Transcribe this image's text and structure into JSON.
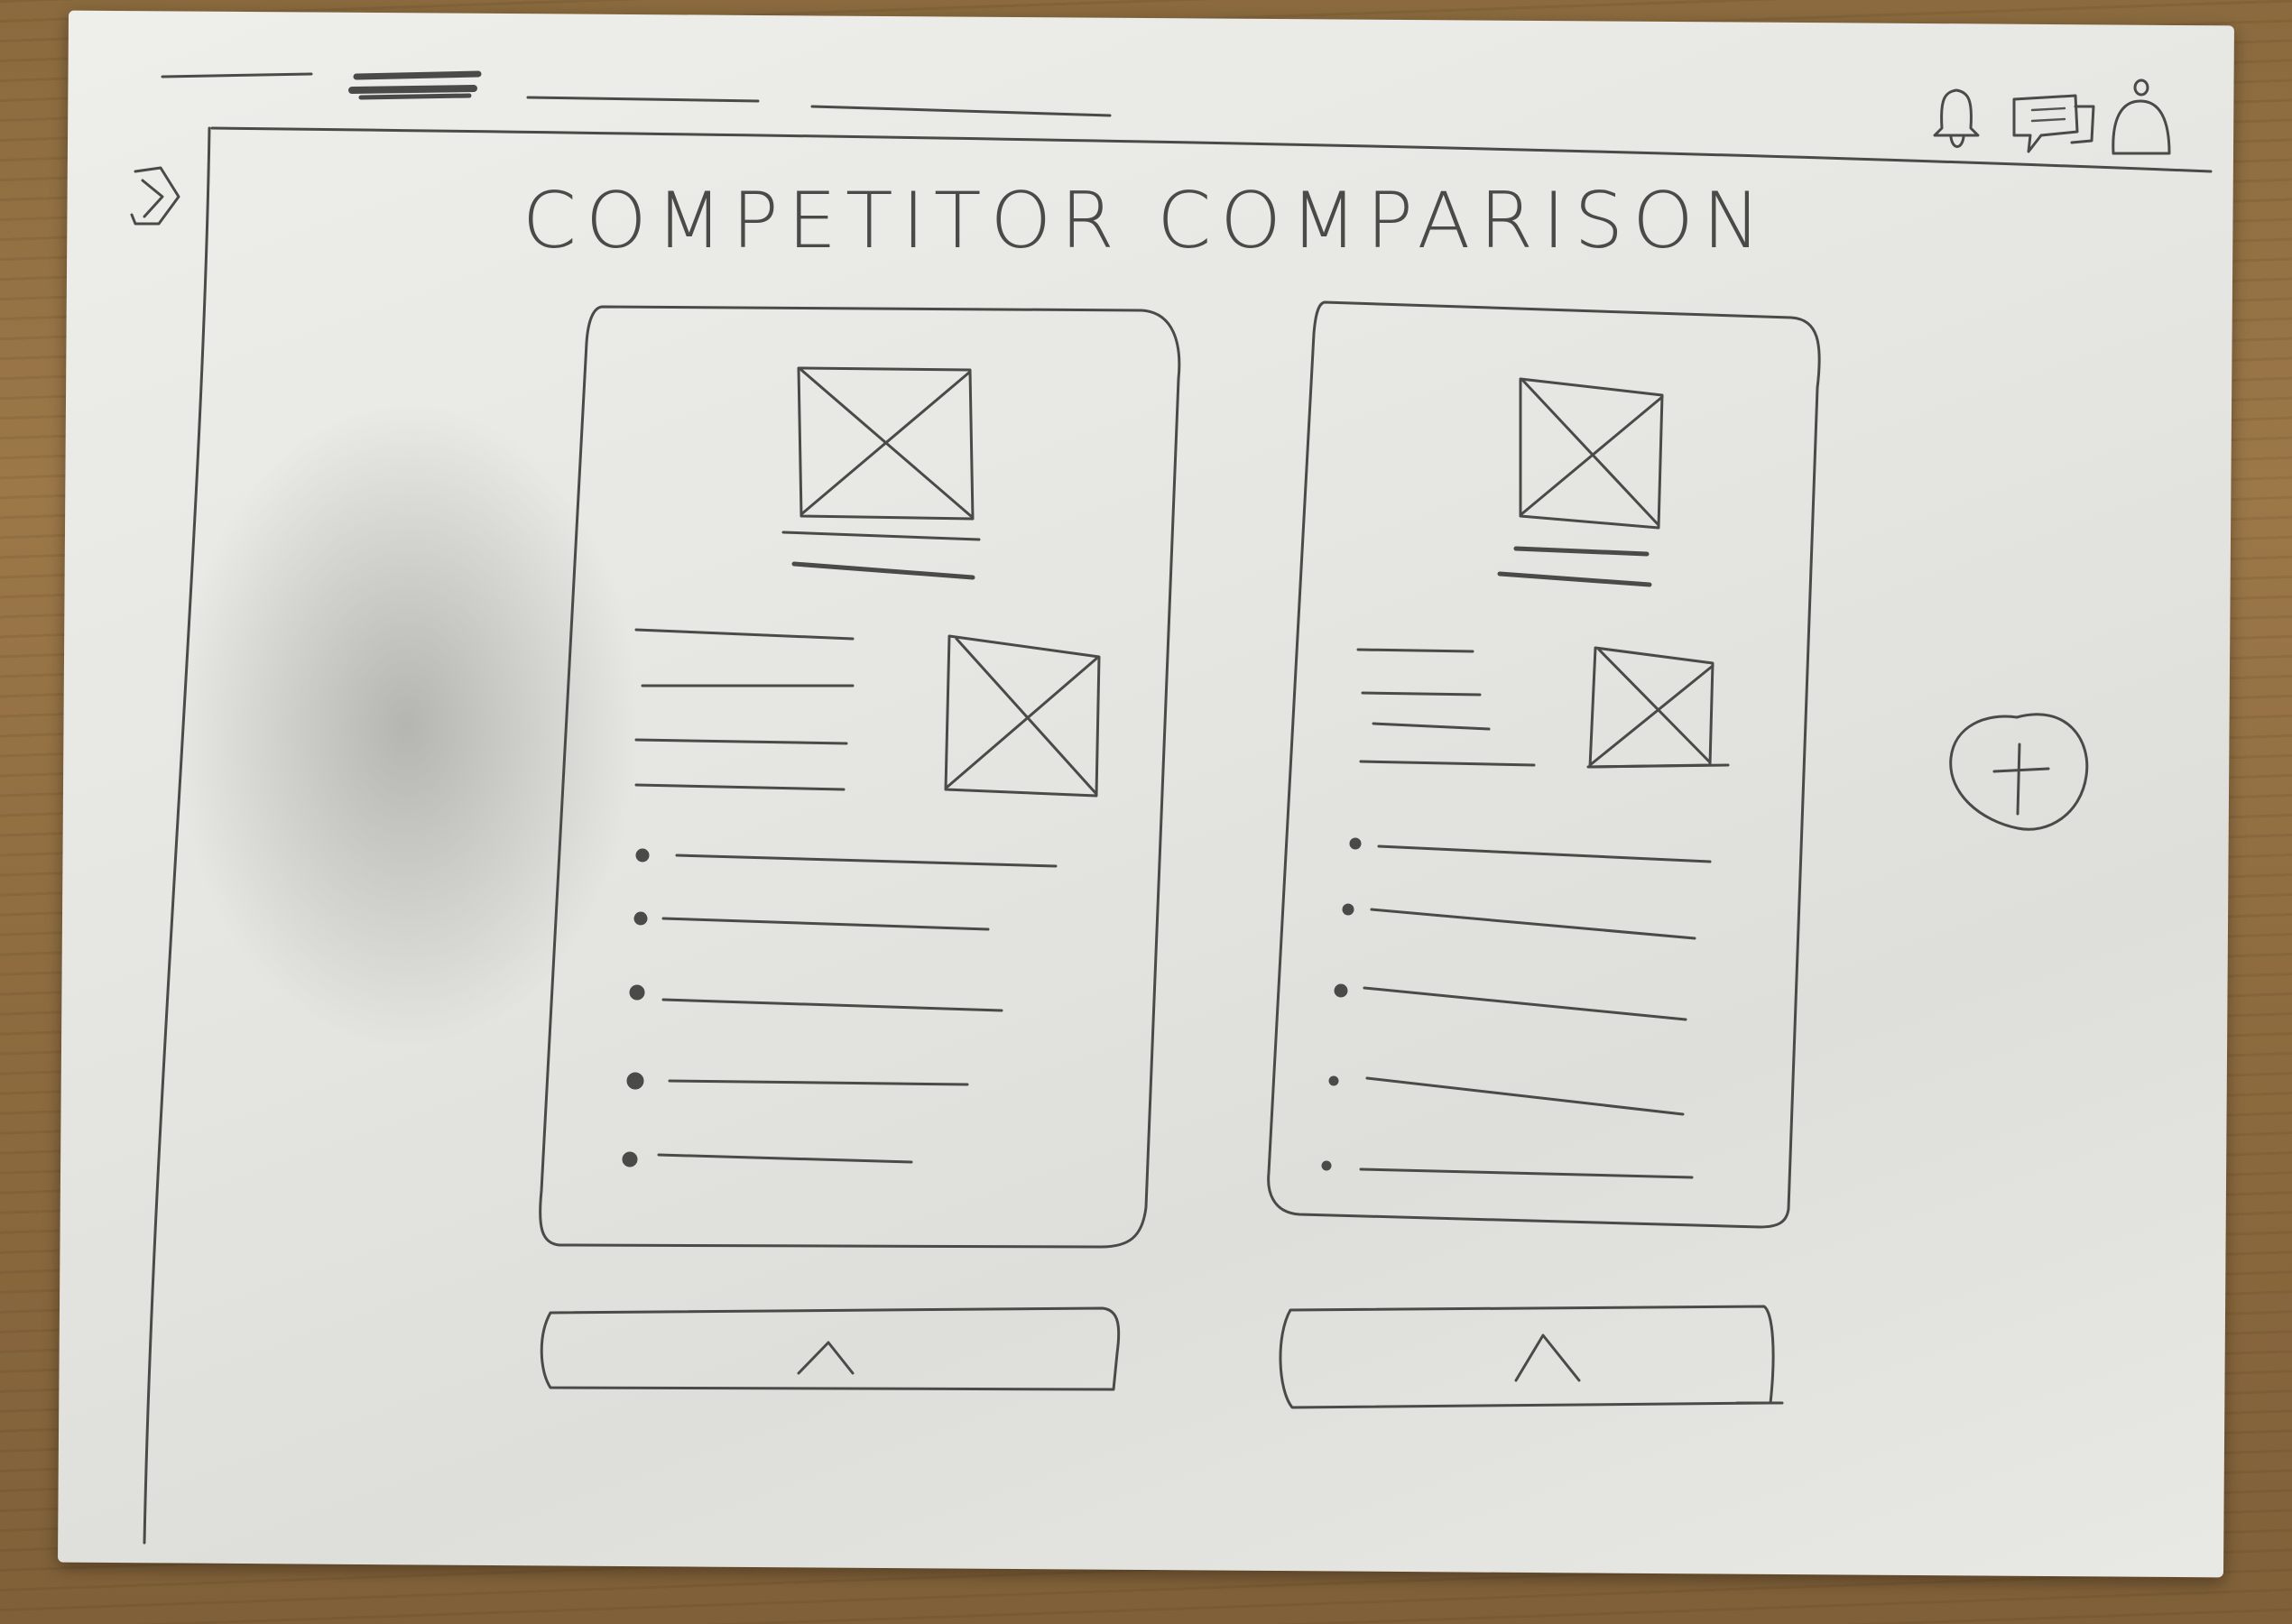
{
  "header": {
    "nav_tabs": [
      {
        "name": "nav-tab-1",
        "active": false
      },
      {
        "name": "nav-tab-2",
        "active": true
      },
      {
        "name": "nav-tab-3",
        "active": false
      },
      {
        "name": "nav-tab-4",
        "active": false
      }
    ],
    "icons": [
      "bell-icon",
      "chat-icon",
      "profile-icon"
    ]
  },
  "sidebar": {
    "toggle_icon": "chevron-right-icon"
  },
  "main": {
    "title": "COMPETITOR COMPARISON",
    "cards": [
      {
        "image_icon": "image-placeholder-icon",
        "thumb_icon": "image-placeholder-icon",
        "bullet_count": 5,
        "collapse_icon": "chevron-up-icon"
      },
      {
        "image_icon": "image-placeholder-icon",
        "thumb_icon": "image-placeholder-icon",
        "bullet_count": 5,
        "collapse_icon": "chevron-up-icon"
      }
    ],
    "add_icon": "plus-icon"
  },
  "colors": {
    "ink": "#4a4a48",
    "paper": "#e6e6e2",
    "table": "#8e6c40"
  }
}
